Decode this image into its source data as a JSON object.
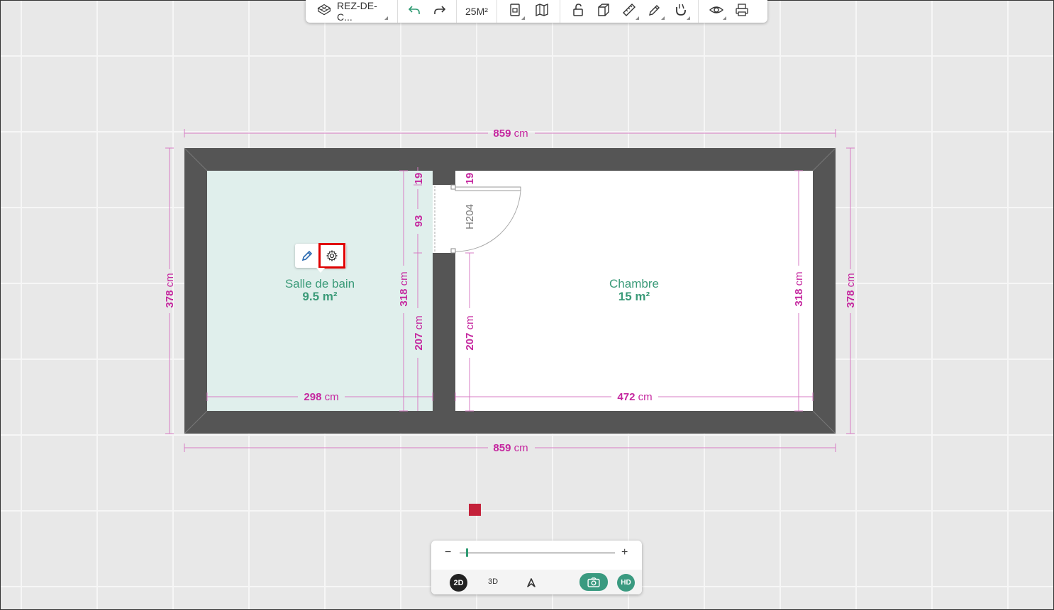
{
  "toolbar": {
    "level_label": "REZ-DE-C...",
    "area_label": "25M²",
    "icons": [
      "level-3d-icon",
      "undo-icon",
      "redo-icon",
      "floor-plan-icon",
      "map-icon",
      "lock-icon",
      "cube-icon",
      "ruler-icon",
      "pencil-icon",
      "magnet-icon",
      "eye-icon",
      "print-icon"
    ]
  },
  "rooms": [
    {
      "name": "Salle de bain",
      "area": "9.5 m²",
      "fill": "#e0efec"
    },
    {
      "name": "Chambre",
      "area": "15 m²",
      "fill": "#ffffff"
    }
  ],
  "dimensions": {
    "top_total": {
      "value": "859",
      "unit": "cm"
    },
    "bottom_total": {
      "value": "859",
      "unit": "cm"
    },
    "left_total": {
      "value": "378",
      "unit": "cm"
    },
    "right_total": {
      "value": "378",
      "unit": "cm"
    },
    "bath_width": {
      "value": "298",
      "unit": "cm"
    },
    "bed_width": {
      "value": "472",
      "unit": "cm"
    },
    "bath_inner_height": {
      "value": "318",
      "unit": "cm"
    },
    "bed_inner_height": {
      "value": "318",
      "unit": "cm"
    },
    "bath_lower_height": {
      "value": "207",
      "unit": "cm"
    },
    "bed_lower_height": {
      "value": "207",
      "unit": "cm"
    },
    "door_offset_top_left": {
      "value": "19"
    },
    "door_offset_top_right": {
      "value": "19"
    },
    "door_width": {
      "value": "93"
    },
    "door_height_label": "H204"
  },
  "colors": {
    "wall": "#555555",
    "dimension": "#c5279f",
    "room_label": "#3a9a78",
    "accent": "#3a9a80",
    "marker": "#c4213a",
    "selection": "#e00000"
  },
  "popover": {
    "icons": [
      "edit-pencil-icon",
      "settings-gear-icon"
    ],
    "selected": "settings-gear-icon"
  },
  "bottom_panel": {
    "zoom_minus": "−",
    "zoom_plus": "+",
    "zoom_level": 0.04,
    "view_2d": "2D",
    "view_3d": "3D",
    "hd": "HD",
    "active_view": "2D"
  }
}
